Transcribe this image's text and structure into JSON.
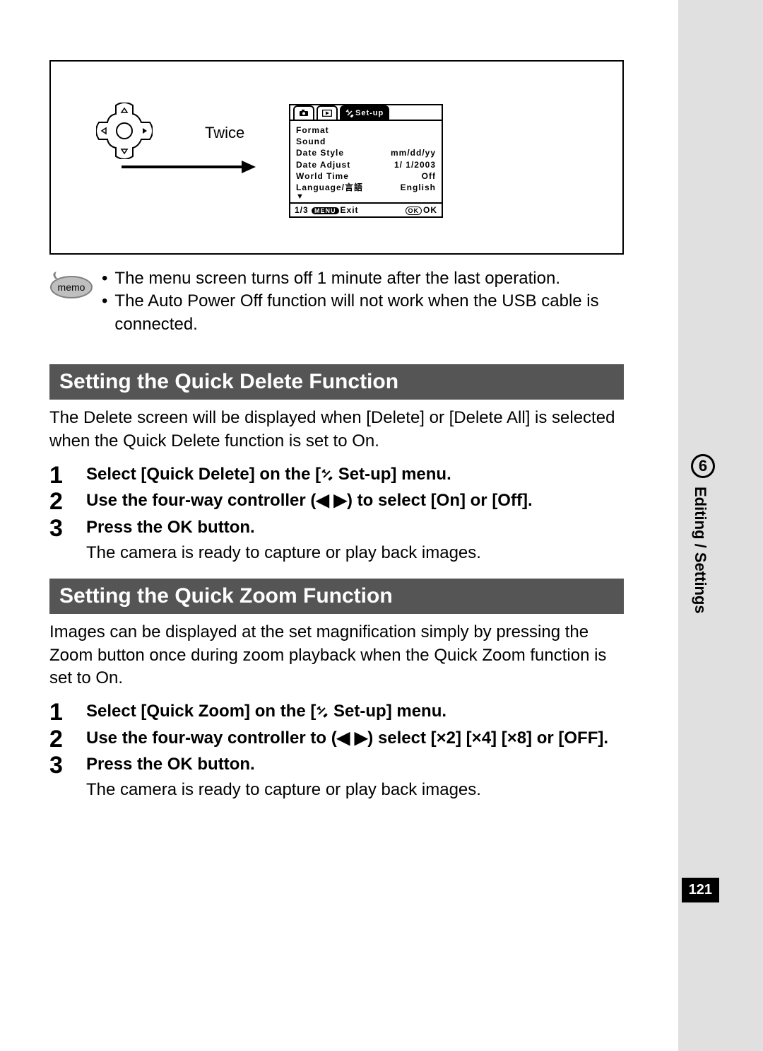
{
  "diagram": {
    "twice_label": "Twice",
    "lcd": {
      "tab_setup": "Set-up",
      "rows": [
        {
          "l": "Format",
          "r": ""
        },
        {
          "l": "Sound",
          "r": ""
        },
        {
          "l": "Date Style",
          "r": "mm/dd/yy"
        },
        {
          "l": "Date Adjust",
          "r": "1/ 1/2003"
        },
        {
          "l": "World Time",
          "r": "Off"
        },
        {
          "l": "Language/言語",
          "r": "English"
        }
      ],
      "footer_left_page": "1/3",
      "footer_left_menu": "MENU",
      "footer_left_exit": "Exit",
      "footer_right_ok_pill": "OK",
      "footer_right_ok": "OK"
    }
  },
  "memo": {
    "items": [
      "The menu screen turns off 1 minute after the last operation.",
      "The Auto Power Off function will not work when the USB cable is connected."
    ]
  },
  "section1": {
    "title": "Setting the Quick Delete Function",
    "intro": "The Delete screen will be displayed when [Delete] or [Delete All] is selected when the Quick Delete function is set to On.",
    "steps": {
      "s1_pre": "Select [Quick Delete] on the [",
      "s1_post": " Set-up] menu.",
      "s2": "Use the four-way controller (◀ ▶) to select [On] or [Off].",
      "s3": "Press the OK button.",
      "s3_sub": "The camera is ready to capture or play back images."
    }
  },
  "section2": {
    "title": "Setting the Quick Zoom Function",
    "intro": "Images can be displayed at the set magnification simply by pressing the Zoom button once during zoom playback when the Quick Zoom function is set to On.",
    "steps": {
      "s1_pre": "Select [Quick Zoom] on the [",
      "s1_post": " Set-up] menu.",
      "s2": "Use the four-way controller to (◀ ▶) select [×2] [×4] [×8] or [OFF].",
      "s3": "Press the OK button.",
      "s3_sub": "The camera is ready to capture or play back images."
    }
  },
  "sidebar": {
    "chapter_num": "6",
    "chapter_label": "Editing / Settings",
    "page_num": "121"
  },
  "nums": {
    "n1": "1",
    "n2": "2",
    "n3": "3"
  }
}
